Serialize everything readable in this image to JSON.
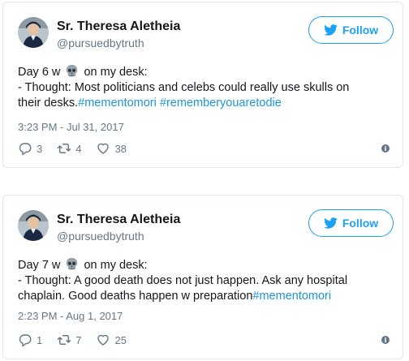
{
  "colors": {
    "accent": "#1da1f2",
    "hashtag": "#1b95e0",
    "muted": "#657786",
    "text": "#14171a"
  },
  "tweets": [
    {
      "name": "Sr. Theresa Aletheia",
      "handle": "@pursuedbytruth",
      "follow_label": "Follow",
      "line1_pre": "Day 6 w",
      "line1_post": "on my desk:",
      "line2": "- Thought: Most politicians and celebs could really use skulls on",
      "line3_pre": "their desks.",
      "tag1": "#mementomori",
      "tag2": "#rememberyouaretodie",
      "timestamp": "3:23 PM - Jul 31, 2017",
      "replies": "3",
      "retweets": "4",
      "likes": "38"
    },
    {
      "name": "Sr. Theresa Aletheia",
      "handle": "@pursuedbytruth",
      "follow_label": "Follow",
      "line1_pre": "Day 7 w",
      "line1_post": "on my desk:",
      "line2": "- Thought: A good death does not just happen. Ask any hospital",
      "line3": "chaplain. Good deaths happen w preparation",
      "tag1": "#mementomori",
      "timestamp": "2:23 PM - Aug 1, 2017",
      "replies": "1",
      "retweets": "7",
      "likes": "25"
    }
  ]
}
